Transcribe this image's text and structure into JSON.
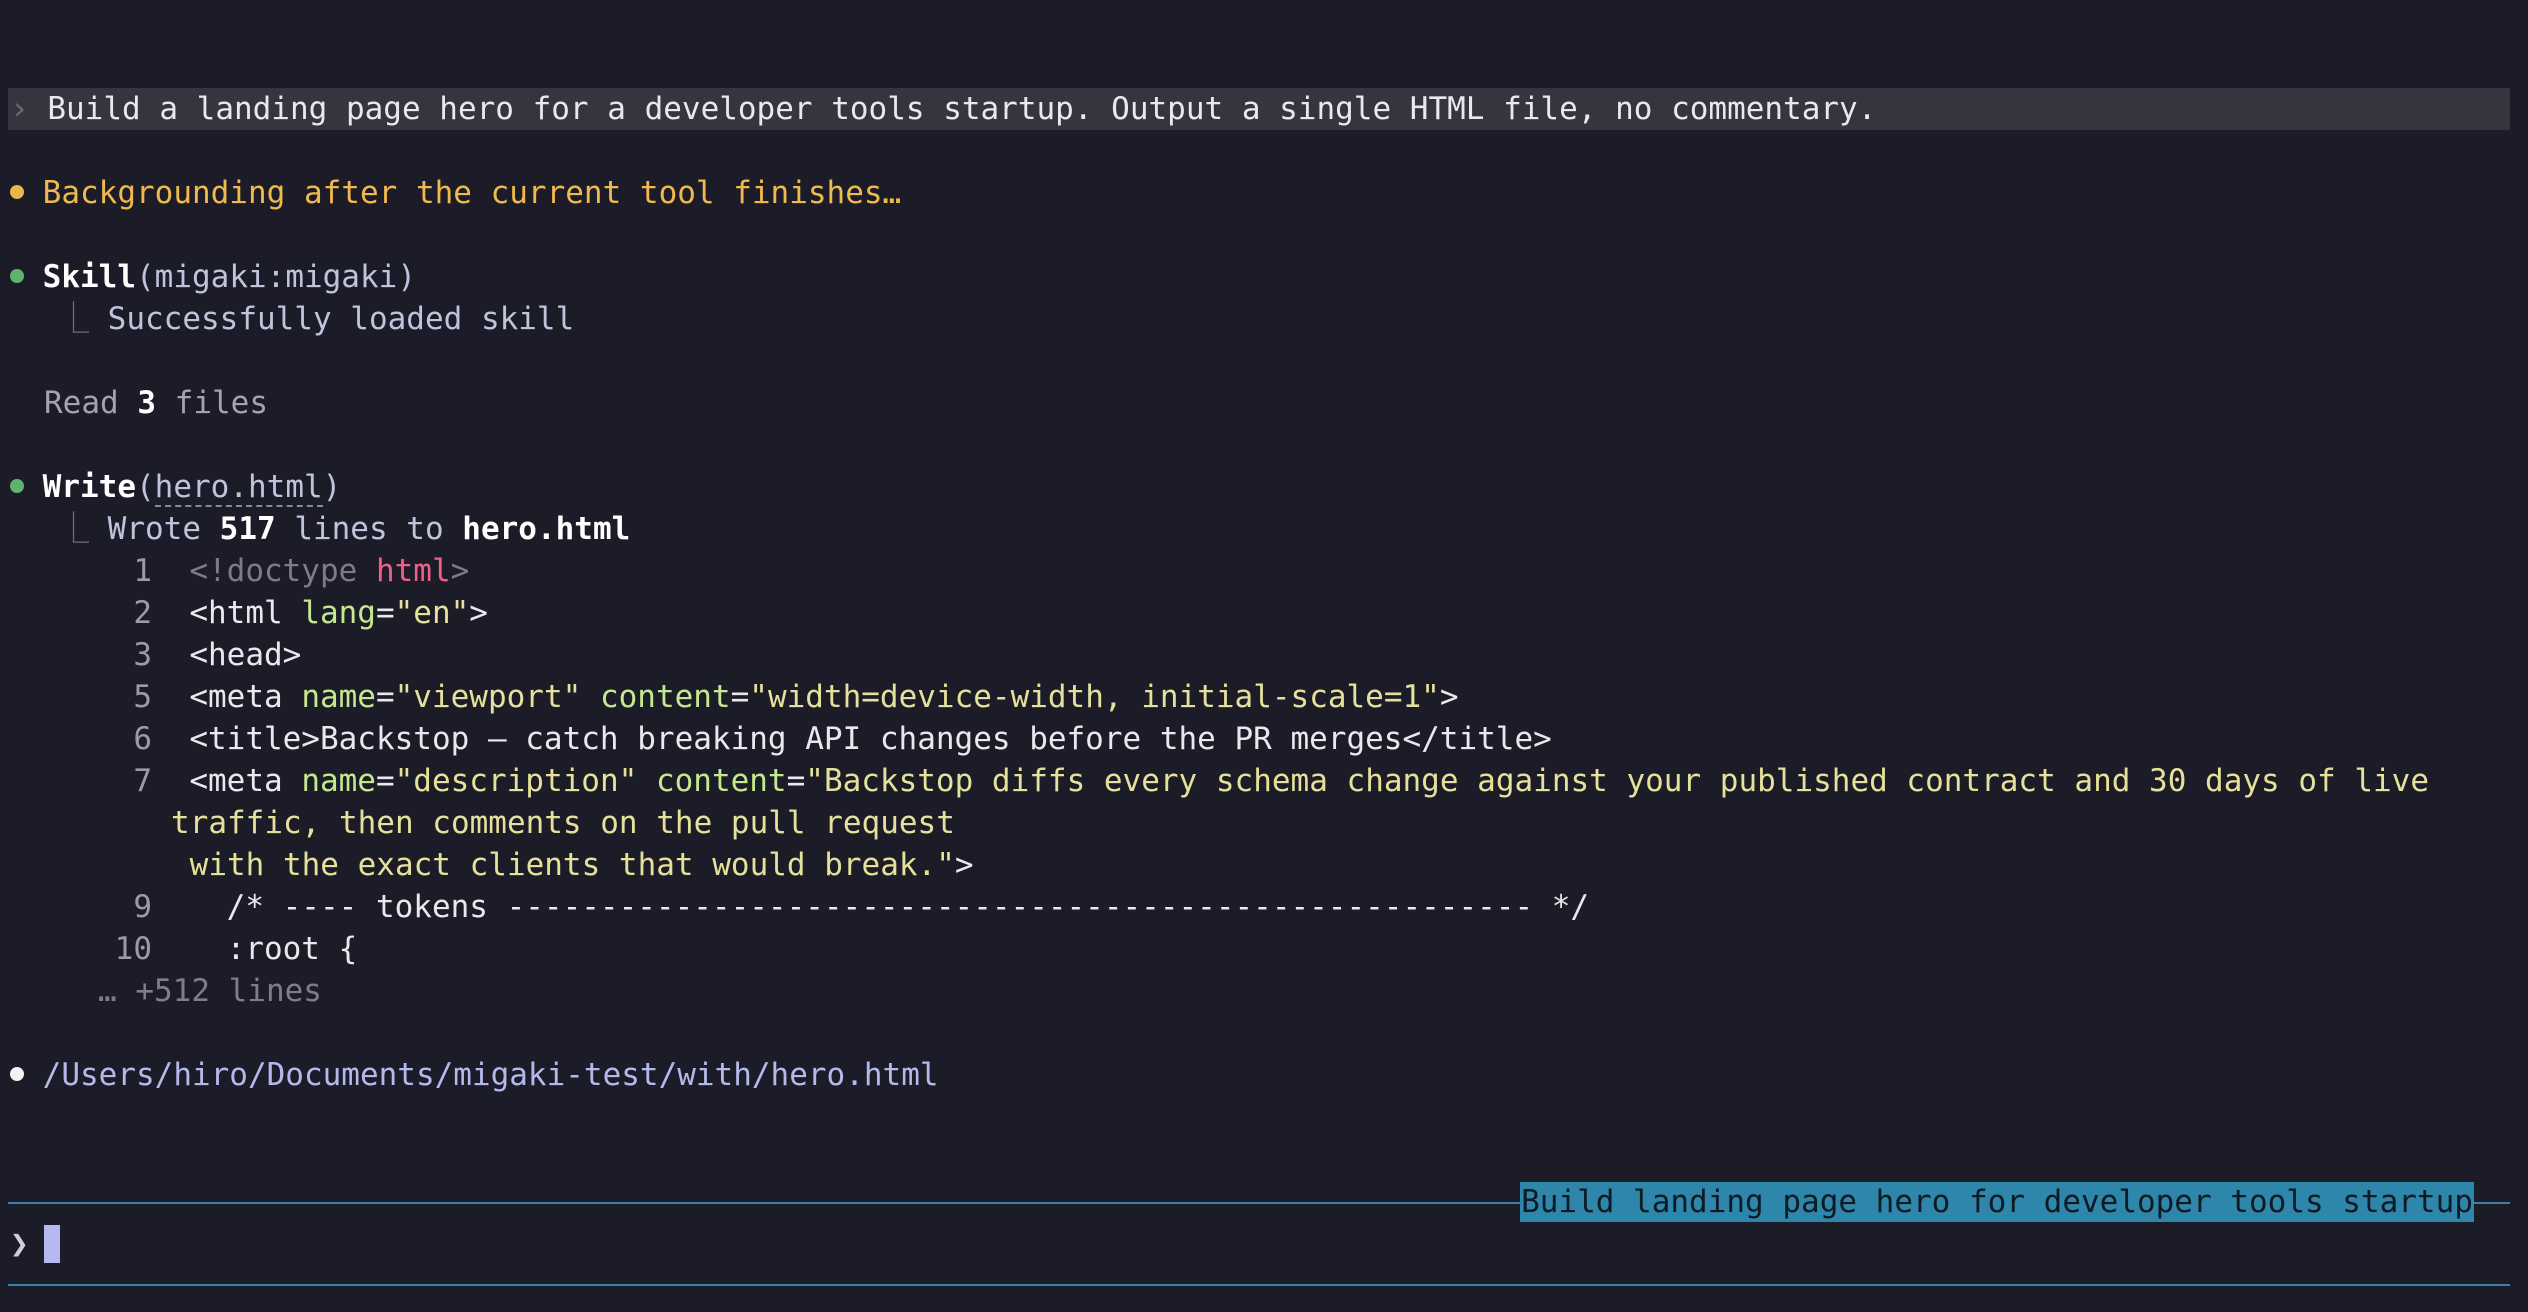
{
  "prompt": {
    "chevron": "›",
    "text": "Build a landing page hero for a developer tools startup. Output a single HTML file, no commentary."
  },
  "status": {
    "text": "Backgrounding after the current tool finishes…"
  },
  "skill": {
    "name": "Skill",
    "arg_open": "(",
    "arg": "migaki:migaki",
    "arg_close": ")",
    "result": "Successfully loaded skill"
  },
  "read": {
    "prefix": "Read ",
    "count": "3",
    "suffix": " files"
  },
  "write": {
    "name": "Write",
    "arg_open": "(",
    "arg": "hero.html",
    "arg_close": ")",
    "result_prefix": "Wrote ",
    "result_count": "517",
    "result_mid": " lines to ",
    "result_file": "hero.html"
  },
  "code": {
    "lines": [
      {
        "num": "1"
      },
      {
        "num": "2"
      },
      {
        "num": "3"
      },
      {
        "num": "5"
      },
      {
        "num": "6"
      },
      {
        "num": "7"
      },
      {
        "num": "9"
      },
      {
        "num": "10"
      }
    ],
    "l1_doctype": "<!doctype ",
    "l1_html": "html",
    "l1_close": ">",
    "l2_open": "<html ",
    "l2_attr": "lang",
    "l2_eq": "=",
    "l2_val": "\"en\"",
    "l2_close": ">",
    "l3": "<head>",
    "l5_open": "<meta ",
    "l5_attr1": "name",
    "l5_eq1": "=",
    "l5_val1": "\"viewport\"",
    "l5_attr2": "content",
    "l5_eq2": "=",
    "l5_val2": "\"width=device-width, initial-scale=1\"",
    "l5_close": ">",
    "l6": "<title>Backstop — catch breaking API changes before the PR merges</title>",
    "l7_open": "<meta ",
    "l7_attr1": "name",
    "l7_eq1": "=",
    "l7_val1": "\"description\"",
    "l7_attr2": "content",
    "l7_eq2": "=",
    "l7_val2a": "\"Backstop diffs every schema change against your published contract and 30 days of live",
    "l7_val2b": "traffic, then comments on the pull request",
    "l7_val2c": " with the exact clients that would break.\"",
    "l7_close": ">",
    "l9": "  /* ---- tokens ------------------------------------------------------- */",
    "l10": "  :root {",
    "more": "… +512 lines"
  },
  "output_path": "/Users/hiro/Documents/migaki-test/with/hero.html",
  "session_title": "Build landing page hero for developer tools startup",
  "input": {
    "chevron": "❯"
  },
  "colors": {
    "background": "#1c1c28",
    "prompt_bar": "#35353f",
    "yellow_dot": "#e9b64a",
    "green_dot": "#5fb36f",
    "accent_line": "#3d7fa8",
    "badge": "#2e86ab",
    "cursor": "#b8b8f0"
  }
}
